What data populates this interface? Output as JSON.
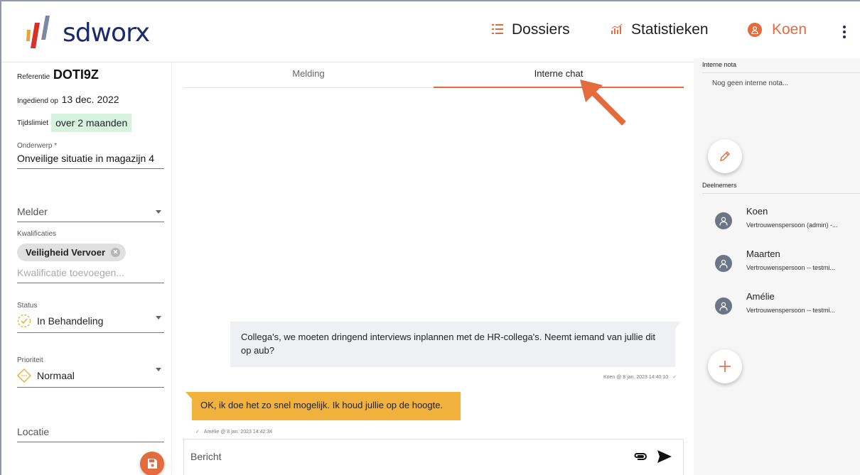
{
  "header": {
    "logo_text": "sdworx",
    "nav": {
      "dossiers": "Dossiers",
      "statistics": "Statistieken",
      "user": "Koen"
    },
    "accent_color": "#e36b3c",
    "brand_color": "#1b2a6b"
  },
  "left": {
    "reference_label": "Referentie",
    "reference_value": "DOTI9Z",
    "submitted_label": "Ingediend op",
    "submitted_value": "13 dec. 2022",
    "deadline_label": "Tijdslimiet",
    "deadline_value": "over 2 maanden",
    "subject_label": "Onderwerp *",
    "subject_value": "Onveilige situatie in magazijn 4",
    "reporter_placeholder": "Melder",
    "qualifications_label": "Kwalificaties",
    "qualification_tag": "Veiligheid Vervoer",
    "qualification_placeholder": "Kwalificatie toevoegen...",
    "status_label": "Status",
    "status_value": "In Behandeling",
    "priority_label": "Prioriteit",
    "priority_value": "Normaal",
    "location_placeholder": "Locatie"
  },
  "chat": {
    "tabs": [
      "Melding",
      "Interne chat"
    ],
    "active_tab": "Interne chat",
    "messages": [
      {
        "text": "Collega's, we moeten dringend interviews inplannen met de HR-collega's. Neemt iemand van jullie dit op aub?",
        "meta": "Koen @ 8 jan. 2023 14:40:10",
        "check": "✓"
      },
      {
        "text": "OK, ik doe het zo snel mogelijk. Ik houd jullie op de hoogte.",
        "meta": "Amélie @ 8 jan. 2023 14:42:34",
        "check": "✓"
      }
    ],
    "composer_placeholder": "Bericht"
  },
  "right": {
    "notes_header": "Interne nota",
    "notes_empty": "Nog geen interne nota...",
    "participants_header": "Deelnemers",
    "participants": [
      {
        "name": "Koen",
        "role": "Vertrouwenspersoon (admin) -..."
      },
      {
        "name": "Maarten",
        "role": "Vertrouwenspersoon -- testmi..."
      },
      {
        "name": "Amélie",
        "role": "Vertrouwenspersoon -- testmi..."
      }
    ]
  }
}
